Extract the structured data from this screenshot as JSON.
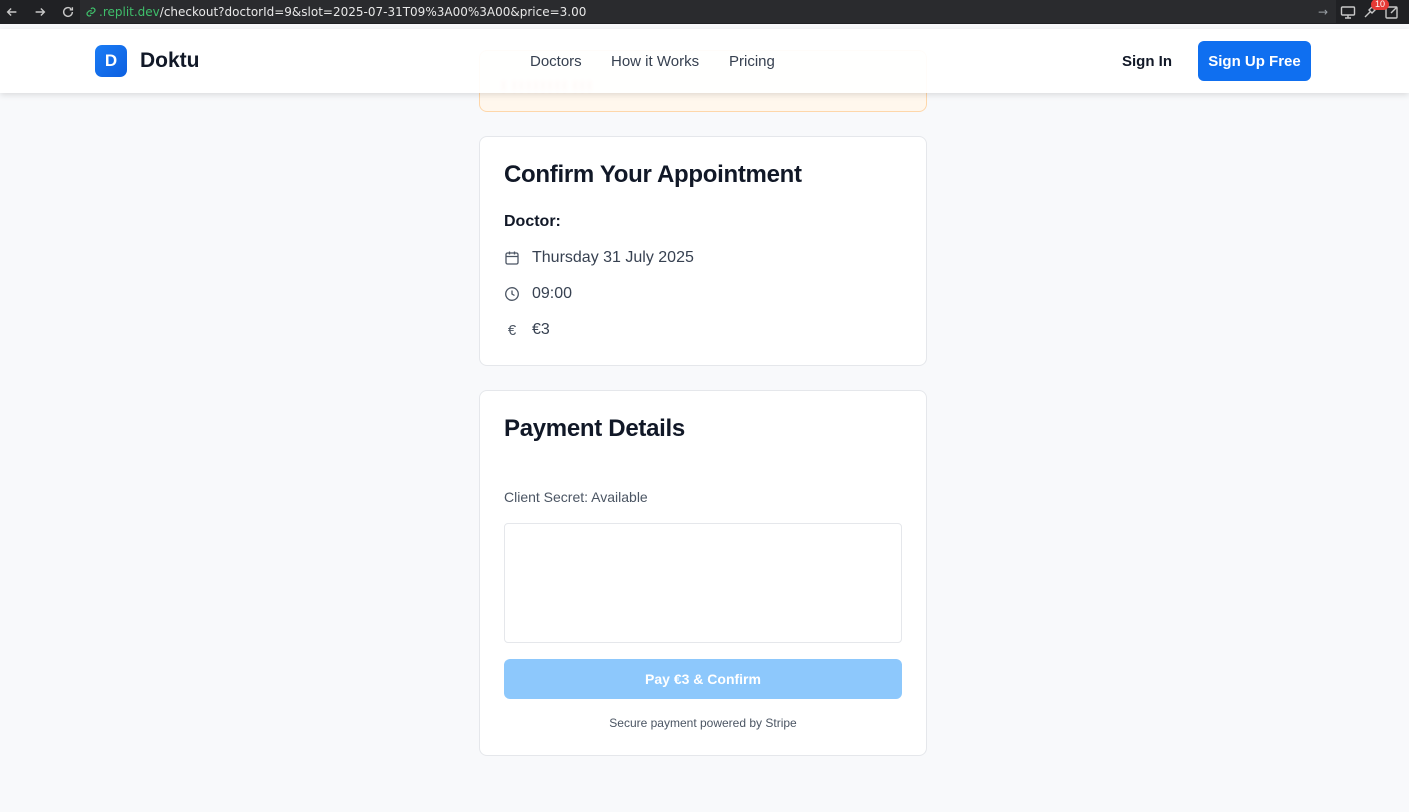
{
  "browser": {
    "url_host": ".replit.dev",
    "url_path": "/checkout?doctorId=9&slot=2025-07-31T09%3A00%3A00&price=3.00",
    "badge_count": "10"
  },
  "header": {
    "logo_letter": "D",
    "brand": "Doktu",
    "nav": [
      "Doctors",
      "How it Works",
      "Pricing"
    ],
    "sign_in": "Sign In",
    "sign_up": "Sign Up Free"
  },
  "appointment": {
    "title": "Confirm Your Appointment",
    "doctor_label": "Doctor:",
    "date": "Thursday 31 July 2025",
    "time": "09:00",
    "price": "€3",
    "icons": [
      "calendar-icon",
      "clock-icon",
      "euro-icon"
    ]
  },
  "payment": {
    "title": "Payment Details",
    "client_secret": "Client Secret: Available",
    "pay_button": "Pay €3 & Confirm",
    "secure_note": "Secure payment powered by Stripe"
  },
  "colors": {
    "accent": "#0f6ff0",
    "pay_button_disabled": "#8dc8fc",
    "page_bg": "#f8f9fb"
  }
}
